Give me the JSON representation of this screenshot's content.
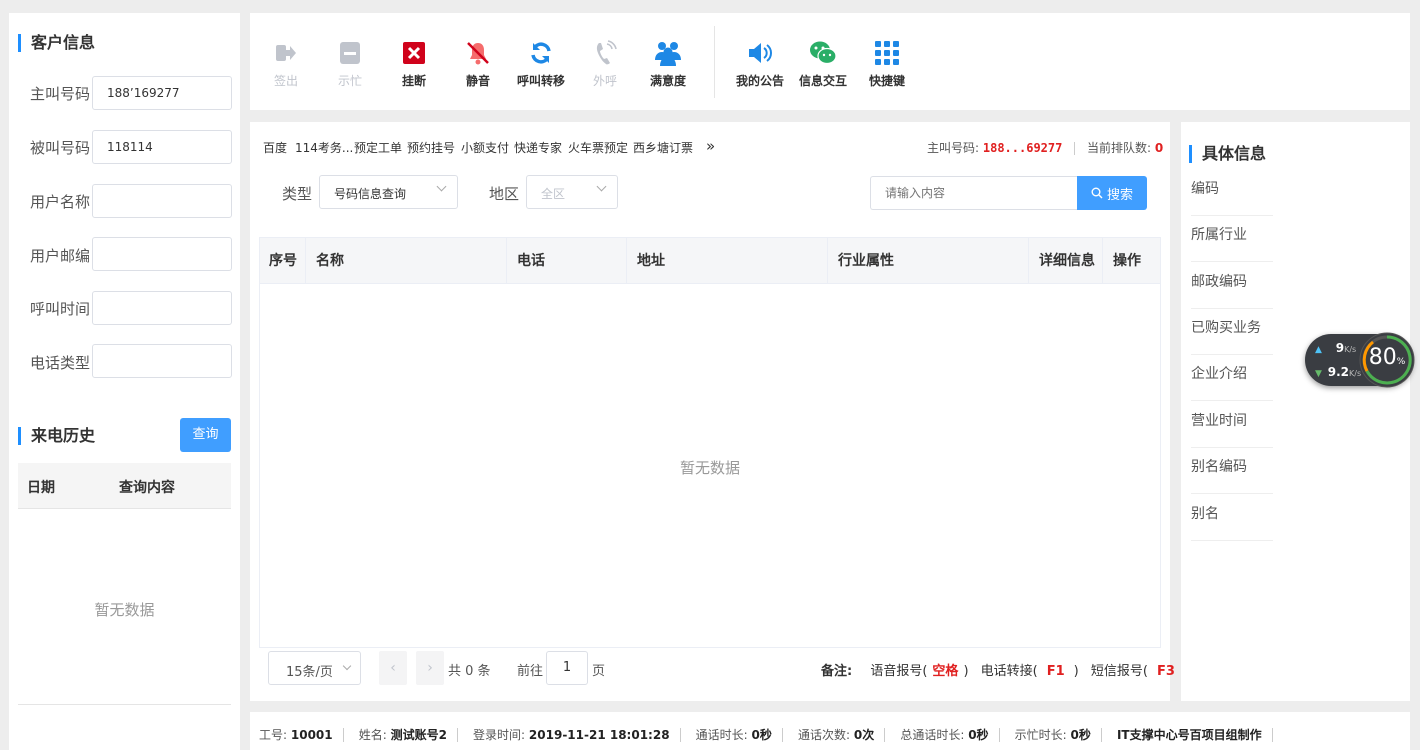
{
  "customer": {
    "title": "客户信息",
    "fields": [
      {
        "label": "主叫号码",
        "value": "188’169277"
      },
      {
        "label": "被叫号码",
        "value": "118114"
      },
      {
        "label": "用户名称",
        "value": ""
      },
      {
        "label": "用户邮编",
        "value": ""
      },
      {
        "label": "呼叫时间",
        "value": ""
      },
      {
        "label": "电话类型",
        "value": ""
      }
    ]
  },
  "history": {
    "title": "来电历史",
    "query_button": "查询",
    "columns": [
      "日期",
      "查询内容"
    ],
    "empty_text": "暂无数据"
  },
  "toolbar": {
    "items": [
      {
        "label": "签出",
        "icon": "sign-out-icon",
        "enabled": false
      },
      {
        "label": "示忙",
        "icon": "busy-icon",
        "enabled": false
      },
      {
        "label": "挂断",
        "icon": "hangup-icon",
        "enabled": true
      },
      {
        "label": "静音",
        "icon": "mute-icon",
        "enabled": true
      },
      {
        "label": "呼叫转移",
        "icon": "transfer-icon",
        "enabled": true
      },
      {
        "label": "外呼",
        "icon": "outbound-call-icon",
        "enabled": false
      },
      {
        "label": "满意度",
        "icon": "satisfaction-icon",
        "enabled": true
      },
      {
        "label": "我的公告",
        "icon": "announcement-icon",
        "enabled": true
      },
      {
        "label": "信息交互",
        "icon": "wechat-icon",
        "enabled": true
      },
      {
        "label": "快捷键",
        "icon": "grid-icon",
        "enabled": true
      }
    ]
  },
  "quick_links": [
    "百度",
    "114考务...",
    "预定工单",
    "预约挂号",
    "小额支付",
    "快递专家",
    "火车票预定",
    "西乡塘订票"
  ],
  "more_glyph": "»",
  "caller": {
    "label": "主叫号码:",
    "value": "188...69277"
  },
  "queue": {
    "label": "当前排队数:",
    "value": "0"
  },
  "filters": {
    "type_label": "类型",
    "type_value": "号码信息查询",
    "region_label": "地区",
    "region_value": "全区",
    "search_placeholder": "请输入内容",
    "search_button": "搜索"
  },
  "table": {
    "columns": [
      "序号",
      "名称",
      "电话",
      "地址",
      "行业属性",
      "详细信息",
      "操作"
    ],
    "empty_text": "暂无数据"
  },
  "pagination": {
    "page_size": "15条/页",
    "total": "共 0 条",
    "goto_prefix": "前往",
    "page": "1",
    "goto_suffix": "页"
  },
  "remarks": {
    "label": "备注:",
    "items": [
      {
        "name": "语音报号(",
        "key": "空格",
        "close": ")"
      },
      {
        "name": "电话转接(",
        "key": "F1",
        "close": ")"
      },
      {
        "name": "短信报号(",
        "key": "F3",
        "close": ")"
      }
    ]
  },
  "details": {
    "title": "具体信息",
    "items": [
      "编码",
      "所属行业",
      "邮政编码",
      "已购买业务",
      "企业介绍",
      "营业时间",
      "别名编码",
      "别名"
    ]
  },
  "net_widget": {
    "up": "9",
    "down": "9.2",
    "unit": "K/s",
    "percent": "80",
    "percent_unit": "%"
  },
  "statusbar": [
    {
      "label": "工号:",
      "value": "10001"
    },
    {
      "label": "姓名:",
      "value": "测试账号2"
    },
    {
      "label": "登录时间:",
      "value": "2019-11-21 18:01:28"
    },
    {
      "label": "通话时长:",
      "value": "0秒"
    },
    {
      "label": "通话次数:",
      "value": "0次"
    },
    {
      "label": "总通话时长:",
      "value": "0秒"
    },
    {
      "label": "示忙时长:",
      "value": "0秒"
    },
    {
      "label": "",
      "value": "IT支撑中心号百项目组制作"
    }
  ],
  "colors": {
    "accent": "#409eff",
    "danger": "#e02020",
    "text": "#333333"
  }
}
